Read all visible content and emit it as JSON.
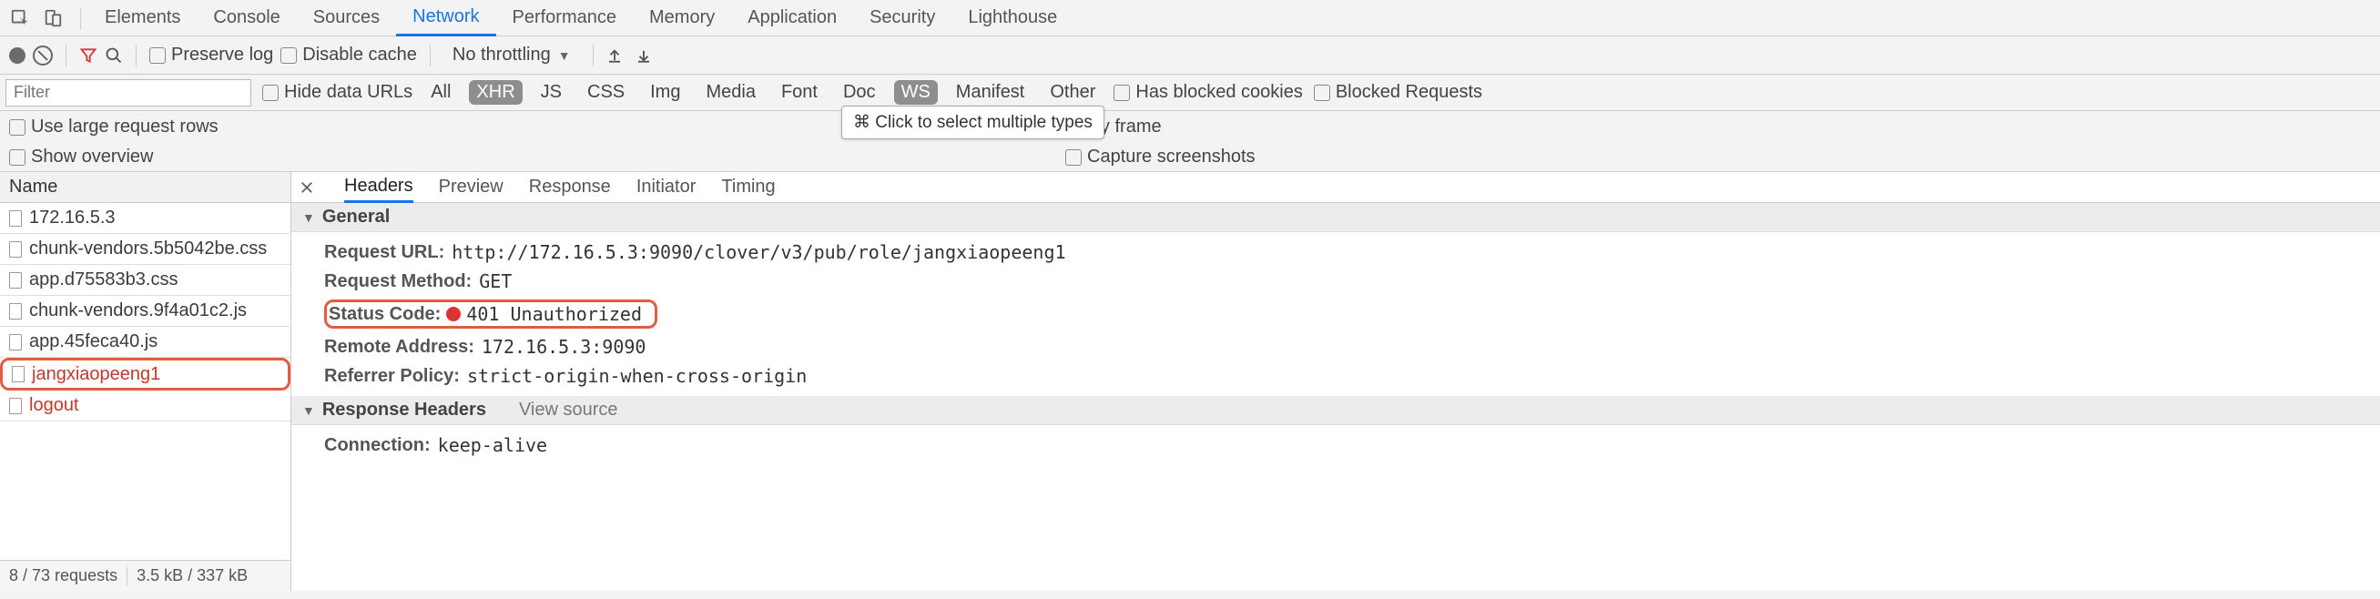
{
  "main_tabs": {
    "items": [
      "Elements",
      "Console",
      "Sources",
      "Network",
      "Performance",
      "Memory",
      "Application",
      "Security",
      "Lighthouse"
    ],
    "active": "Network"
  },
  "toolbar": {
    "preserve_log": "Preserve log",
    "disable_cache": "Disable cache",
    "throttling": "No throttling"
  },
  "filter_row": {
    "placeholder": "Filter",
    "hide_data_urls": "Hide data URLs",
    "types": [
      "All",
      "XHR",
      "JS",
      "CSS",
      "Img",
      "Media",
      "Font",
      "Doc",
      "WS",
      "Manifest",
      "Other"
    ],
    "active_types": [
      "XHR",
      "WS"
    ],
    "has_blocked_cookies": "Has blocked cookies",
    "blocked_requests": "Blocked Requests",
    "tooltip": "⌘ Click to select multiple types"
  },
  "options": {
    "large_rows": "Use large request rows",
    "group_by_frame": "up by frame",
    "show_overview": "Show overview",
    "capture_screenshots": "Capture screenshots"
  },
  "left": {
    "header": "Name",
    "items": [
      {
        "label": "172.16.5.3",
        "red": false,
        "highlight": false
      },
      {
        "label": "chunk-vendors.5b5042be.css",
        "red": false,
        "highlight": false
      },
      {
        "label": "app.d75583b3.css",
        "red": false,
        "highlight": false
      },
      {
        "label": "chunk-vendors.9f4a01c2.js",
        "red": false,
        "highlight": false
      },
      {
        "label": "app.45feca40.js",
        "red": false,
        "highlight": false
      },
      {
        "label": "jangxiaopeeng1",
        "red": true,
        "highlight": true
      },
      {
        "label": "logout",
        "red": true,
        "highlight": false
      }
    ],
    "footer": {
      "requests": "8 / 73 requests",
      "size": "3.5 kB / 337 kB"
    }
  },
  "detail_tabs": {
    "items": [
      "Headers",
      "Preview",
      "Response",
      "Initiator",
      "Timing"
    ],
    "active": "Headers"
  },
  "sections": {
    "general_title": "General",
    "general": {
      "request_url_key": "Request URL:",
      "request_url_val": "http://172.16.5.3:9090/clover/v3/pub/role/jangxiaopeeng1",
      "request_method_key": "Request Method:",
      "request_method_val": "GET",
      "status_code_key": "Status Code:",
      "status_code_val": "401 Unauthorized",
      "remote_address_key": "Remote Address:",
      "remote_address_val": "172.16.5.3:9090",
      "referrer_policy_key": "Referrer Policy:",
      "referrer_policy_val": "strict-origin-when-cross-origin"
    },
    "response_headers_title": "Response Headers",
    "view_source": "View source",
    "response_headers": {
      "connection_key": "Connection:",
      "connection_val": "keep-alive"
    }
  }
}
